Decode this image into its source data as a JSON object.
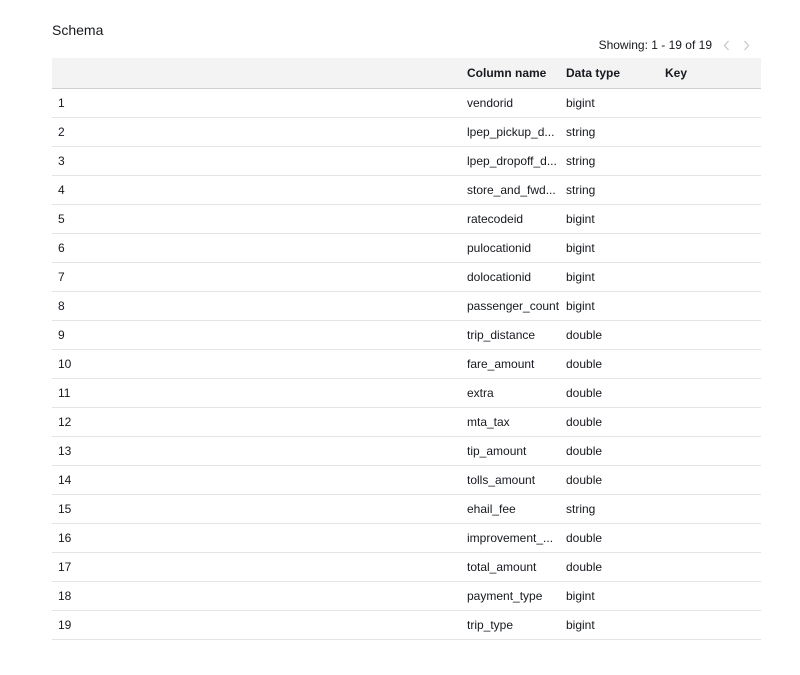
{
  "schema": {
    "title": "Schema",
    "pager": {
      "text": "Showing: 1 - 19 of 19",
      "prev_icon": "chevron-left-icon",
      "next_icon": "chevron-right-icon"
    },
    "columns": {
      "index": "",
      "name": "Column name",
      "type": "Data type",
      "key": "Key"
    },
    "rows": [
      {
        "index": "1",
        "name": "vendorid",
        "type": "bigint",
        "key": ""
      },
      {
        "index": "2",
        "name": "lpep_pickup_d...",
        "type": "string",
        "key": ""
      },
      {
        "index": "3",
        "name": "lpep_dropoff_d...",
        "type": "string",
        "key": ""
      },
      {
        "index": "4",
        "name": "store_and_fwd...",
        "type": "string",
        "key": ""
      },
      {
        "index": "5",
        "name": "ratecodeid",
        "type": "bigint",
        "key": ""
      },
      {
        "index": "6",
        "name": "pulocationid",
        "type": "bigint",
        "key": ""
      },
      {
        "index": "7",
        "name": "dolocationid",
        "type": "bigint",
        "key": ""
      },
      {
        "index": "8",
        "name": "passenger_count",
        "type": "bigint",
        "key": ""
      },
      {
        "index": "9",
        "name": "trip_distance",
        "type": "double",
        "key": ""
      },
      {
        "index": "10",
        "name": "fare_amount",
        "type": "double",
        "key": ""
      },
      {
        "index": "11",
        "name": "extra",
        "type": "double",
        "key": ""
      },
      {
        "index": "12",
        "name": "mta_tax",
        "type": "double",
        "key": ""
      },
      {
        "index": "13",
        "name": "tip_amount",
        "type": "double",
        "key": ""
      },
      {
        "index": "14",
        "name": "tolls_amount",
        "type": "double",
        "key": ""
      },
      {
        "index": "15",
        "name": "ehail_fee",
        "type": "string",
        "key": ""
      },
      {
        "index": "16",
        "name": "improvement_...",
        "type": "double",
        "key": ""
      },
      {
        "index": "17",
        "name": "total_amount",
        "type": "double",
        "key": ""
      },
      {
        "index": "18",
        "name": "payment_type",
        "type": "bigint",
        "key": ""
      },
      {
        "index": "19",
        "name": "trip_type",
        "type": "bigint",
        "key": ""
      }
    ]
  }
}
